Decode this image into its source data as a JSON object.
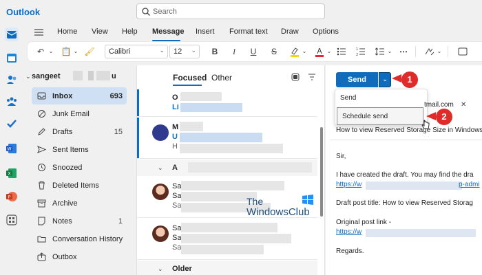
{
  "app": {
    "title": "Outlook"
  },
  "search": {
    "placeholder": "Search"
  },
  "ribbon": {
    "tabs": [
      "Home",
      "View",
      "Help",
      "Message",
      "Insert",
      "Format text",
      "Draw",
      "Options"
    ],
    "active_tab": "Message",
    "font_name": "Calibri",
    "font_size": "12"
  },
  "folders": {
    "account": "sangeet",
    "account_suffix": "u",
    "items": [
      {
        "label": "Inbox",
        "count": "693",
        "icon": "inbox-icon",
        "active": true
      },
      {
        "label": "Junk Email",
        "count": "",
        "icon": "junk-icon"
      },
      {
        "label": "Drafts",
        "count": "15",
        "icon": "pencil-icon"
      },
      {
        "label": "Sent Items",
        "count": "",
        "icon": "send-icon"
      },
      {
        "label": "Snoozed",
        "count": "",
        "icon": "clock-icon"
      },
      {
        "label": "Deleted Items",
        "count": "",
        "icon": "trash-icon"
      },
      {
        "label": "Archive",
        "count": "",
        "icon": "archive-icon"
      },
      {
        "label": "Notes",
        "count": "1",
        "icon": "note-icon"
      },
      {
        "label": "Conversation History",
        "count": "",
        "icon": "folder-icon"
      },
      {
        "label": "Outbox",
        "count": "",
        "icon": "outbox-icon"
      }
    ]
  },
  "message_list": {
    "tab_focused": "Focused",
    "tab_other": "Other",
    "groups": [
      "A",
      "Older"
    ],
    "senders": [
      "O",
      "M",
      "Sa",
      "Sa"
    ],
    "subject_initials": [
      "Li",
      "U",
      "H",
      "Sa",
      "Sa",
      "Sa",
      "Sa"
    ]
  },
  "watermark": {
    "line1": "The",
    "line2": "WindowsClub"
  },
  "compose": {
    "send_label": "Send",
    "dropdown": [
      "Send",
      "Schedule send"
    ],
    "callouts": [
      "1",
      "2"
    ],
    "recipient_domain": "tmail.com",
    "subject": "How to view Reserved Storage Size in Windows",
    "body": {
      "greeting": "Sir,",
      "line1": "I have created the draft. You may find the dra",
      "link1_start": "https://w",
      "link1_end": "p-admi",
      "line2": "Draft post title: How to view Reserved Storag",
      "line3": "Original post link -",
      "link2_start": "https://w",
      "closing": "Regards."
    }
  },
  "colors": {
    "accent": "#0f6cbd",
    "callout": "#e02b2b"
  }
}
